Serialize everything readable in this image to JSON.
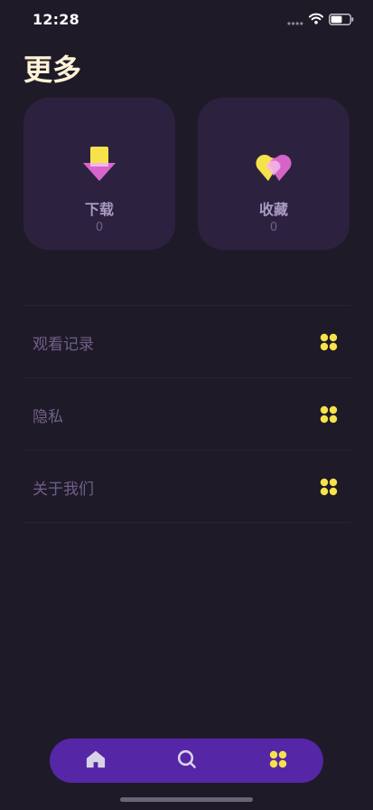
{
  "status_bar": {
    "time": "12:28",
    "icons": [
      "signal-dots-icon",
      "wifi-icon",
      "battery-icon"
    ],
    "battery_level": 0.6
  },
  "header": {
    "title": "更多"
  },
  "cards": [
    {
      "label": "下载",
      "count": "0",
      "icon": "download-arrow-icon"
    },
    {
      "label": "收藏",
      "count": "0",
      "icon": "heart-icon"
    }
  ],
  "menu": [
    {
      "label": "观看记录",
      "icon": "four-dots-icon"
    },
    {
      "label": "隐私",
      "icon": "four-dots-icon"
    },
    {
      "label": "关于我们",
      "icon": "four-dots-icon"
    }
  ],
  "tab_bar": {
    "tabs": [
      {
        "icon": "home-icon",
        "selected": false
      },
      {
        "icon": "search-icon",
        "selected": false
      },
      {
        "icon": "four-dots-icon",
        "selected": true
      }
    ]
  },
  "colors": {
    "background": "#1f1a28",
    "card": "#2c2240",
    "accent_yellow": "#f6e24a",
    "accent_pink": "#e86bd8",
    "tab_bar": "#5526a6",
    "title": "#fff3d6"
  }
}
